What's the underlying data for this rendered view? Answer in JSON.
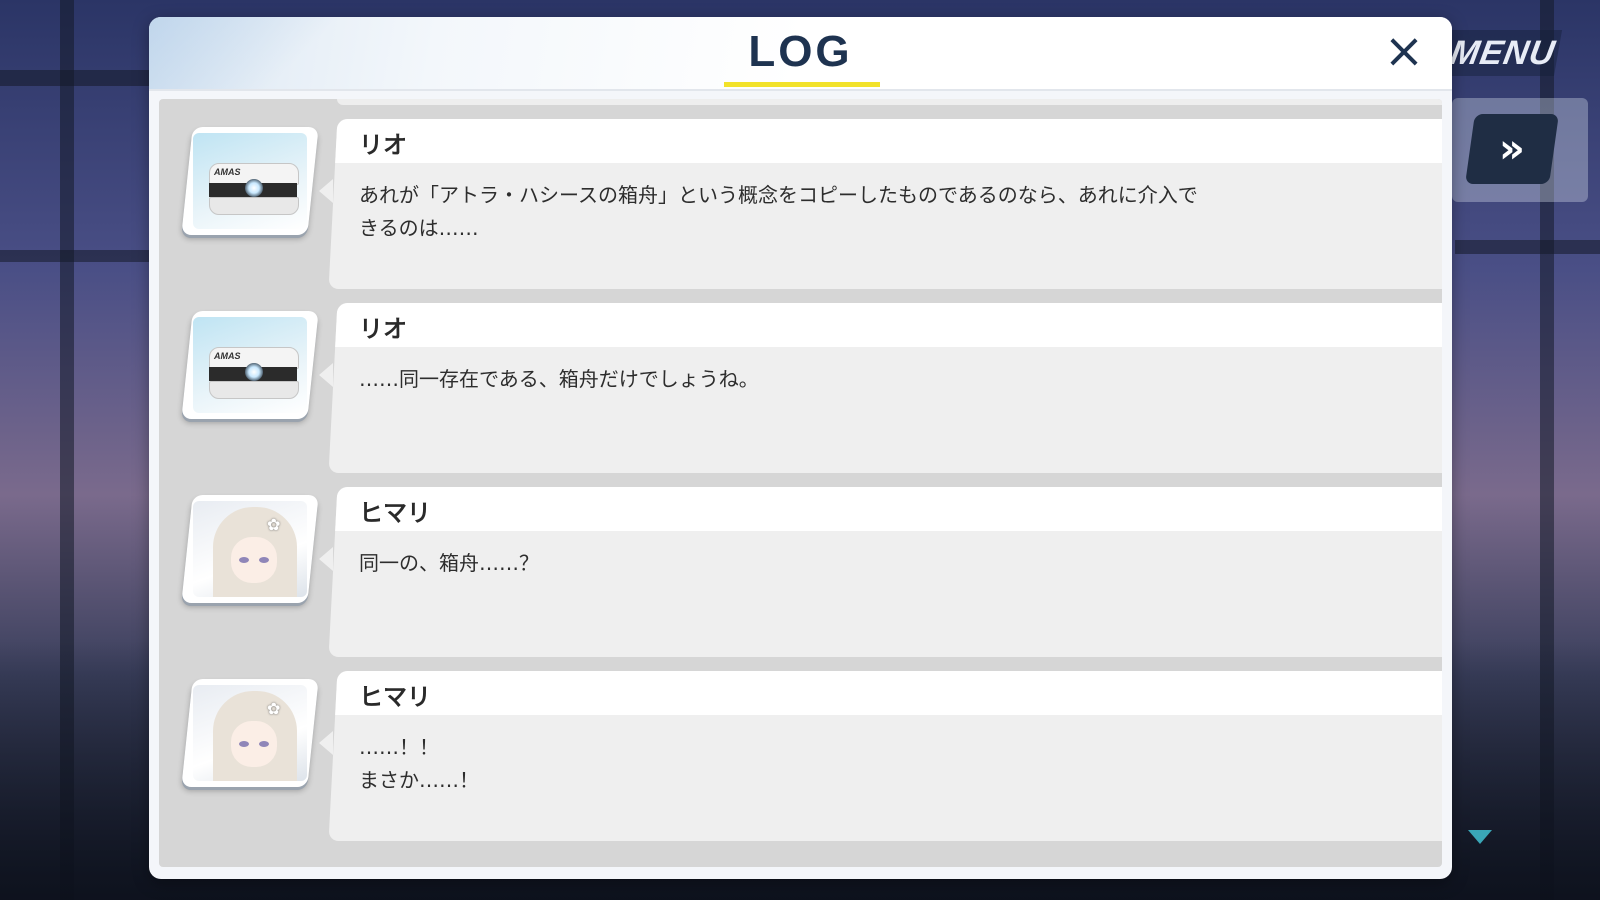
{
  "window": {
    "title": "LOG",
    "close_icon": "×"
  },
  "hud": {
    "menu_label": "MENU",
    "fast_forward_icon": "»",
    "scroll_down_icon": "▼"
  },
  "entries": [
    {
      "speaker": "リオ",
      "portrait": "amas-device",
      "portrait_label": "AMAS",
      "text": "あれが「アトラ・ハシースの箱舟」という概念をコピーしたものであるのなら、あれに介入で\nきるのは……"
    },
    {
      "speaker": "リオ",
      "portrait": "amas-device",
      "portrait_label": "AMAS",
      "text": "……同一存在である、箱舟だけでしょうね。"
    },
    {
      "speaker": "ヒマリ",
      "portrait": "himari",
      "text": "同一の、箱舟……？"
    },
    {
      "speaker": "ヒマリ",
      "portrait": "himari",
      "text": "……！！\nまさか……！"
    }
  ]
}
